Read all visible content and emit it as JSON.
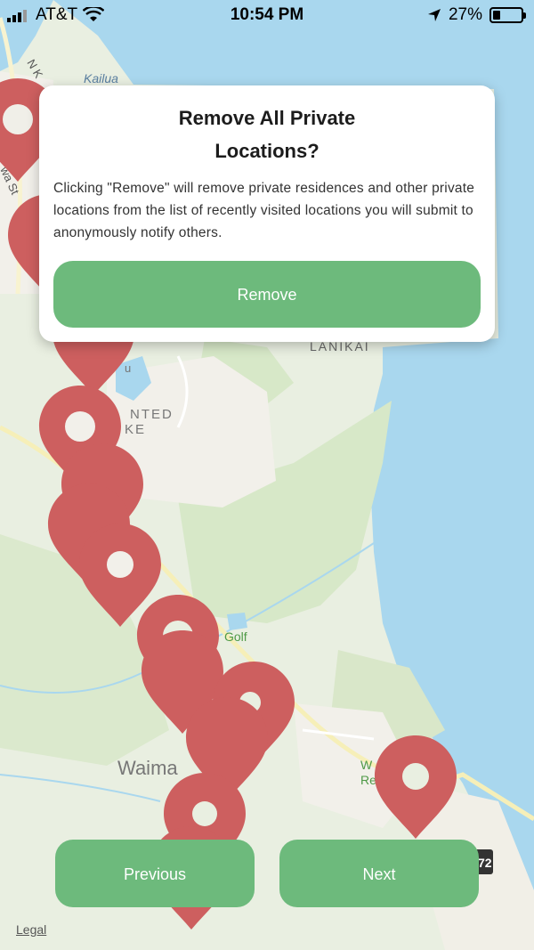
{
  "status_bar": {
    "carrier": "AT&T",
    "time": "10:54 PM",
    "battery": "27%",
    "battery_level": 0.27
  },
  "map": {
    "labels": {
      "kailua": "Kailua",
      "lanikai": "LANIKAI",
      "enchanted_line1": "NTED",
      "enchanted_line2": "KE",
      "golf": "Golf",
      "waimanalo": "Waima",
      "rec_line1": "W anal  y",
      "rec_line2": "Re  at   ea",
      "street": "wa St",
      "nk": "N K",
      "u": "u",
      "route": "72"
    },
    "legal": "Legal"
  },
  "dialog": {
    "title": "Remove All Private Locations?",
    "message": "Clicking \"Remove\" will remove private residences and other private locations from the list of recently visited locations you will submit to anonymously notify others.",
    "remove_label": "Remove"
  },
  "footer": {
    "previous_label": "Previous",
    "next_label": "Next"
  },
  "colors": {
    "accent": "#6dba7c",
    "pin": "#cd5f5f",
    "water": "#a9d7ee",
    "land": "#e9efe1"
  }
}
